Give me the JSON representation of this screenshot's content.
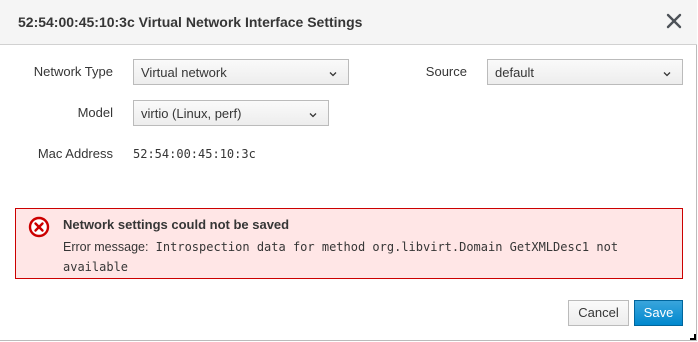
{
  "dialog": {
    "title": "52:54:00:45:10:3c Virtual Network Interface Settings",
    "close_icon": "close-icon"
  },
  "form": {
    "network_type": {
      "label": "Network Type",
      "value": "Virtual network"
    },
    "source": {
      "label": "Source",
      "value": "default"
    },
    "model": {
      "label": "Model",
      "value": "virtio (Linux, perf)"
    },
    "mac_address": {
      "label": "Mac Address",
      "value": "52:54:00:45:10:3c"
    }
  },
  "alert": {
    "icon": "error-circle-icon",
    "title": "Network settings could not be saved",
    "message_prefix": "Error message:",
    "message_line1": " Introspection data for method org.libvirt.Domain GetXMLDesc1 not",
    "message_line2": "available"
  },
  "footer": {
    "cancel_label": "Cancel",
    "save_label": "Save"
  },
  "colors": {
    "header_bg": "#f5f5f5",
    "alert_bg": "#ffe6e6",
    "alert_border": "#cc0000",
    "primary": "#0088ce"
  }
}
